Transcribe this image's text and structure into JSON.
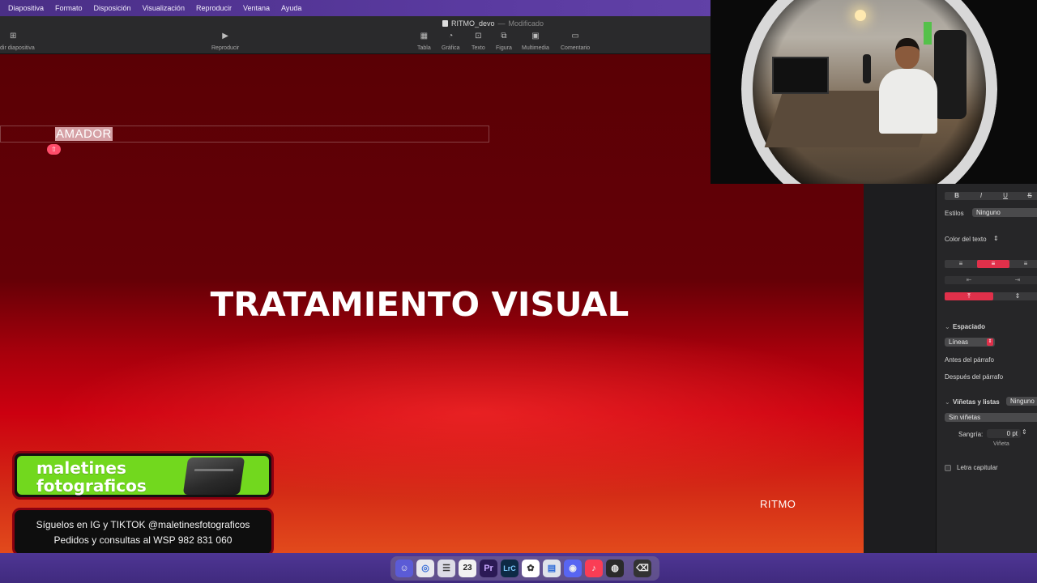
{
  "menubar": {
    "items": [
      "Diapositiva",
      "Formato",
      "Disposición",
      "Visualización",
      "Reproducir",
      "Ventana",
      "Ayuda"
    ]
  },
  "toolbar": {
    "doc_title": "RITMO_devo",
    "doc_separator": "—",
    "doc_status": "Modificado",
    "add_slide_label": "dir diapositiva",
    "play_label": "Reproducir",
    "table_label": "Tabla",
    "chart_label": "Gráfica",
    "text_label": "Texto",
    "shape_label": "Figura",
    "media_label": "Multimedia",
    "comment_label": "Comentario"
  },
  "slide": {
    "selected_text": "AMADOR",
    "title": "TRATAMIENTO VISUAL",
    "footer_text": "RITMO"
  },
  "inspector": {
    "bold": "B",
    "italic": "I",
    "underline": "U",
    "strike": "S",
    "styles_label": "Estilos",
    "styles_value": "Ninguno",
    "text_color_label": "Color del texto",
    "spacing_label": "Espaciado",
    "spacing_value": "Líneas",
    "before_paragraph": "Antes del párrafo",
    "after_paragraph": "Después del párrafo",
    "bullets_label": "Viñetas y listas",
    "bullets_value": "Ninguno",
    "bullets_style": "Sin viñetas",
    "indent_label": "Sangría:",
    "indent_value": "0 pt",
    "indent_sub": "Viñeta",
    "dropcap_label": "Letra capitular"
  },
  "promo": {
    "brand_line1": "maletines",
    "brand_line2": "fotograficos",
    "line1": "Síguelos en IG y TIKTOK @maletinesfotograficos",
    "line2": "Pedidos y consultas al WSP 982 831 060"
  },
  "dock": {
    "calendar_day": "23",
    "premiere": "Pr",
    "lightroom": "LrC"
  },
  "colors": {
    "accent": "#e0304a",
    "menubar": "#5a3aa0",
    "promo_green": "#72d81e"
  }
}
